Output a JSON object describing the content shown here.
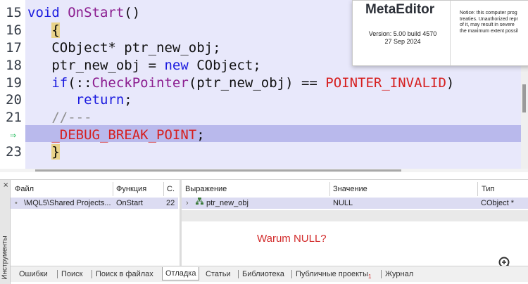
{
  "editor": {
    "lines": [
      {
        "num": "15",
        "parts": [
          [
            "kw",
            "void "
          ],
          [
            "fn",
            "OnStart"
          ],
          [
            "plain",
            "()"
          ]
        ]
      },
      {
        "num": "16",
        "parts": [
          [
            "plain",
            "   "
          ],
          [
            "gold",
            "{"
          ]
        ]
      },
      {
        "num": "17",
        "parts": [
          [
            "plain",
            "   CObject* ptr_new_obj;"
          ]
        ]
      },
      {
        "num": "18",
        "parts": [
          [
            "plain",
            "   ptr_new_obj = "
          ],
          [
            "kw",
            "new"
          ],
          [
            "plain",
            " CObject;"
          ]
        ]
      },
      {
        "num": "19",
        "parts": [
          [
            "plain",
            "   "
          ],
          [
            "kw",
            "if"
          ],
          [
            "plain",
            "(::"
          ],
          [
            "fn",
            "CheckPointer"
          ],
          [
            "plain",
            "(ptr_new_obj) == "
          ],
          [
            "red",
            "POINTER_INVALID"
          ],
          [
            "plain",
            ")"
          ]
        ]
      },
      {
        "num": "20",
        "parts": [
          [
            "plain",
            "      "
          ],
          [
            "kw",
            "return"
          ],
          [
            "plain",
            ";"
          ]
        ]
      },
      {
        "num": "21",
        "parts": [
          [
            "cm",
            "   //---"
          ]
        ]
      },
      {
        "num": "⇒",
        "parts": [
          [
            "plain",
            "   "
          ],
          [
            "red",
            "_DEBUG_BREAK_POINT"
          ],
          [
            "plain",
            ";"
          ]
        ]
      },
      {
        "num": "23",
        "parts": [
          [
            "plain",
            "   "
          ],
          [
            "gold",
            "}"
          ]
        ]
      }
    ],
    "tail_comment": "   //",
    "current_line_index": 7
  },
  "about": {
    "title": "MetaEditor",
    "version": "Version: 5.00 build 4570",
    "date": "27 Sep 2024",
    "notice": "Notice: this computer prog\ntreaties. Unauthorized repr\nof it, may result in severe\nthe maximum extent possil"
  },
  "panel": {
    "side_label": "Инструменты",
    "close_glyph": "×",
    "left_headers": [
      "Файл",
      "Функция",
      "С."
    ],
    "left_row": {
      "file": "\\MQL5\\Shared Projects...",
      "func": "OnStart",
      "line": "22"
    },
    "right_headers": [
      "Выражение",
      "Значение",
      "Тип"
    ],
    "watch_row": {
      "expr": "ptr_new_obj",
      "value": "NULL",
      "type": "CObject *"
    },
    "annotation": "Warum NULL?"
  },
  "tabs": {
    "items": [
      "Ошибки",
      "Поиск",
      "Поиск в файлах",
      "Отладка",
      "Статьи",
      "Библиотека",
      "Публичные проекты",
      "Журнал"
    ],
    "active": "Отладка",
    "badge": "1"
  },
  "colors": {
    "keyword": "#1b1bdf",
    "function": "#8b1d8f",
    "error": "#d62020",
    "highlight": "#b9b9ec"
  }
}
